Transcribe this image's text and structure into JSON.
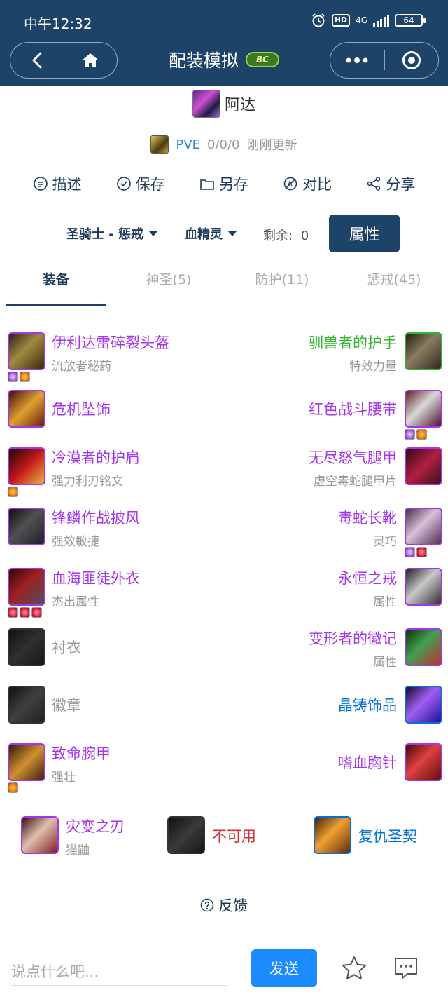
{
  "status": {
    "time": "中午12:32",
    "hd": "HD",
    "network": "4G",
    "battery": "64"
  },
  "nav": {
    "title": "配装模拟",
    "logo_text": "BC"
  },
  "character": {
    "name": "阿达",
    "mode": "PVE",
    "score": "0/0/0",
    "updated": "刚刚更新"
  },
  "actions": [
    {
      "label": "描述",
      "icon": "describe-icon"
    },
    {
      "label": "保存",
      "icon": "check-circle-icon"
    },
    {
      "label": "另存",
      "icon": "folder-icon"
    },
    {
      "label": "对比",
      "icon": "compare-icon"
    },
    {
      "label": "分享",
      "icon": "share-icon"
    }
  ],
  "selectors": {
    "class_spec": "圣骑士 - 惩戒",
    "race": "血精灵",
    "remain_label": "剩余:",
    "remain_value": "0",
    "attr_button": "属性"
  },
  "tabs": [
    {
      "label": "装备",
      "active": true
    },
    {
      "label": "神圣(5)",
      "active": false
    },
    {
      "label": "防护(11)",
      "active": false
    },
    {
      "label": "惩戒(45)",
      "active": false
    }
  ],
  "left_gear": [
    {
      "name": "伊利达雷碎裂头盔",
      "sub": "流放者秘药",
      "quality": "epic",
      "gems": [
        "purple",
        "orange"
      ]
    },
    {
      "name": "危机坠饰",
      "sub": "",
      "quality": "epic",
      "gems": []
    },
    {
      "name": "冷漠者的护肩",
      "sub": "强力利刃铭文",
      "quality": "epic",
      "gems": [
        "orange"
      ]
    },
    {
      "name": "锋鳞作战披风",
      "sub": "强效敏捷",
      "quality": "epic",
      "gems": []
    },
    {
      "name": "血海匪徒外衣",
      "sub": "杰出属性",
      "quality": "epic",
      "gems": [
        "red",
        "red",
        "red"
      ]
    },
    {
      "name": "衬衣",
      "sub": "",
      "quality": "empty",
      "gems": []
    },
    {
      "name": "徽章",
      "sub": "",
      "quality": "empty",
      "gems": []
    },
    {
      "name": "致命腕甲",
      "sub": "强壮",
      "quality": "epic",
      "gems": [
        "orange"
      ]
    }
  ],
  "right_gear": [
    {
      "name": "驯兽者的护手",
      "sub": "特效力量",
      "quality": "uncommon",
      "gems": []
    },
    {
      "name": "红色战斗腰带",
      "sub": "",
      "quality": "epic",
      "gems": [
        "purple",
        "orange"
      ]
    },
    {
      "name": "无尽怒气腿甲",
      "sub": "虚空毒蛇腿甲片",
      "quality": "epic",
      "gems": []
    },
    {
      "name": "毒蛇长靴",
      "sub": "灵巧",
      "quality": "epic",
      "gems": [
        "purple",
        "red"
      ]
    },
    {
      "name": "永恒之戒",
      "sub": "属性",
      "quality": "epic",
      "gems": []
    },
    {
      "name": "变形者的徽记",
      "sub": "属性",
      "quality": "epic",
      "gems": []
    },
    {
      "name": "晶铸饰品",
      "sub": "",
      "quality": "rare",
      "gems": []
    },
    {
      "name": "嗜血胸针",
      "sub": "",
      "quality": "epic",
      "gems": []
    }
  ],
  "weapons": [
    {
      "name": "灾变之刃",
      "sub": "猫鼬",
      "quality": "epic"
    },
    {
      "name": "不可用",
      "sub": "",
      "quality": "red"
    },
    {
      "name": "复仇圣契",
      "sub": "",
      "quality": "rare"
    }
  ],
  "feedback": "反馈",
  "comment": {
    "placeholder": "说点什么吧...",
    "send": "发送"
  }
}
